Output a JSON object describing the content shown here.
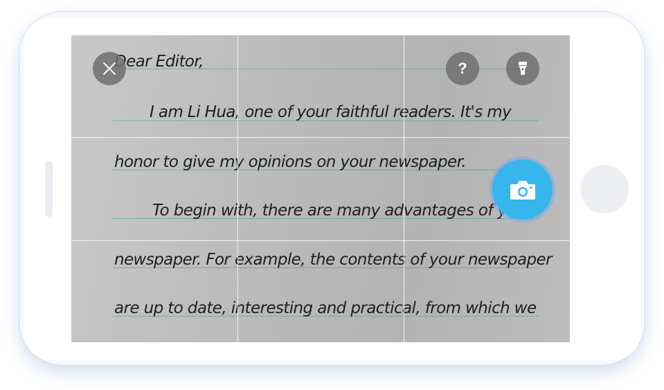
{
  "document": {
    "lines": [
      "Dear Editor,",
      "I am Li Hua, one of your faithful readers. It's my",
      "honor to give my opinions on your newspaper.",
      "To begin with, there are many advantages of your",
      "newspaper. For example, the contents of your newspaper",
      "are up to date, interesting and practical, from which we"
    ]
  },
  "controls": {
    "help_label": "?",
    "close_icon": "close-icon",
    "flash_icon": "flashlight-icon",
    "shutter_icon": "camera-icon"
  },
  "colors": {
    "shutter": "#36b6ec",
    "control_bg": "#6e6e6e",
    "ruled_line": "#5fa892"
  }
}
